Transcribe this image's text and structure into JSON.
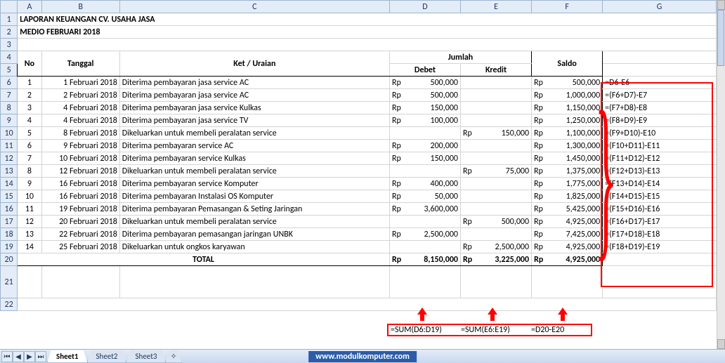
{
  "columns": [
    "A",
    "B",
    "C",
    "D",
    "E",
    "F",
    "G"
  ],
  "title1": "LAPORAN KEUANGAN CV. USAHA JASA",
  "title2": "MEDIO FEBRUARI 2018",
  "headers": {
    "no": "No",
    "tanggal": "Tanggal",
    "ket": "Ket / Uraian",
    "jumlah": "Jumlah",
    "debet": "Debet",
    "kredit": "Kredit",
    "saldo": "Saldo",
    "rp": "Rp"
  },
  "rows": [
    {
      "no": "1",
      "tgl": "1 Februari 2018",
      "ket": "Diterima pembayaran jasa service AC",
      "deb": "500,000",
      "kre": "",
      "saldo": "500,000",
      "f": "=D6-E6"
    },
    {
      "no": "2",
      "tgl": "2 Februari 2018",
      "ket": "Diterima pembayaran jasa service AC",
      "deb": "500,000",
      "kre": "",
      "saldo": "1,000,000",
      "f": "=(F6+D7)-E7"
    },
    {
      "no": "3",
      "tgl": "4 Februari 2018",
      "ket": "Diterima pembayaran jasa service Kulkas",
      "deb": "150,000",
      "kre": "",
      "saldo": "1,150,000",
      "f": "=(F7+D8)-E8"
    },
    {
      "no": "4",
      "tgl": "4 Februari 2018",
      "ket": "Diterima pembayaran jasa service TV",
      "deb": "100,000",
      "kre": "",
      "saldo": "1,250,000",
      "f": "=(F8+D9)-E9"
    },
    {
      "no": "5",
      "tgl": "8 Februari 2018",
      "ket": "Dikeluarkan untuk membeli peralatan service",
      "deb": "",
      "kre": "150,000",
      "saldo": "1,100,000",
      "f": "=(F9+D10)-E10"
    },
    {
      "no": "6",
      "tgl": "9 Februari 2018",
      "ket": "Diterima pembayaran service AC",
      "deb": "200,000",
      "kre": "",
      "saldo": "1,300,000",
      "f": "=(F10+D11)-E11"
    },
    {
      "no": "7",
      "tgl": "10 Februari 2018",
      "ket": "Diterima pembayaran service Kulkas",
      "deb": "150,000",
      "kre": "",
      "saldo": "1,450,000",
      "f": "=(F11+D12)-E12"
    },
    {
      "no": "8",
      "tgl": "12 Februari 2018",
      "ket": "Dikeluarkan untuk membeli peralatan service",
      "deb": "",
      "kre": "75,000",
      "saldo": "1,375,000",
      "f": "=(F12+D13)-E13"
    },
    {
      "no": "9",
      "tgl": "16 Februari 2018",
      "ket": "Diterima pembayaran service Komputer",
      "deb": "400,000",
      "kre": "",
      "saldo": "1,775,000",
      "f": "=(F13+D14)-E14"
    },
    {
      "no": "10",
      "tgl": "16 Februari 2018",
      "ket": "Diterima pembayaran Instalasi OS Komputer",
      "deb": "50,000",
      "kre": "",
      "saldo": "1,825,000",
      "f": "=(F14+D15)-E15"
    },
    {
      "no": "11",
      "tgl": "19 Februari 2018",
      "ket": "Diterima pembayaran Pemasangan & Seting Jaringan",
      "deb": "3,600,000",
      "kre": "",
      "saldo": "5,425,000",
      "f": "=(F15+D16)-E16"
    },
    {
      "no": "12",
      "tgl": "20 Februari 2018",
      "ket": "Dikeluarkan untuk membeli peralatan service",
      "deb": "",
      "kre": "500,000",
      "saldo": "4,925,000",
      "f": "=(F16+D17)-E17"
    },
    {
      "no": "13",
      "tgl": "22 Februari 2018",
      "ket": "Diterima pembayaran pemasangan jaringan UNBK",
      "deb": "2,500,000",
      "kre": "",
      "saldo": "7,425,000",
      "f": "=(F17+D18)-E18"
    },
    {
      "no": "14",
      "tgl": "25 Februari 2018",
      "ket": "Dikeluarkan untuk ongkos karyawan",
      "deb": "",
      "kre": "2,500,000",
      "saldo": "4,925,000",
      "f": "=(F18+D19)-E19"
    }
  ],
  "total": {
    "label": "TOTAL",
    "deb": "8,150,000",
    "kre": "3,225,000",
    "saldo": "4,925,000"
  },
  "sum_formulas": {
    "d": "=SUM(D6:D19)",
    "e": "=SUM(E6:E19)",
    "f": "=D20-E20"
  },
  "tabs": [
    "Sheet1",
    "Sheet2",
    "Sheet3"
  ],
  "footer_url": "www.modulkomputer.com",
  "chart_data": {
    "type": "table",
    "title": "LAPORAN KEUANGAN CV. USAHA JASA — MEDIO FEBRUARI 2018",
    "columns": [
      "No",
      "Tanggal",
      "Ket / Uraian",
      "Debet",
      "Kredit",
      "Saldo"
    ],
    "rows": [
      [
        1,
        "1 Februari 2018",
        "Diterima pembayaran jasa service AC",
        500000,
        null,
        500000
      ],
      [
        2,
        "2 Februari 2018",
        "Diterima pembayaran jasa service AC",
        500000,
        null,
        1000000
      ],
      [
        3,
        "4 Februari 2018",
        "Diterima pembayaran jasa service Kulkas",
        150000,
        null,
        1150000
      ],
      [
        4,
        "4 Februari 2018",
        "Diterima pembayaran jasa service TV",
        100000,
        null,
        1250000
      ],
      [
        5,
        "8 Februari 2018",
        "Dikeluarkan untuk membeli peralatan service",
        null,
        150000,
        1100000
      ],
      [
        6,
        "9 Februari 2018",
        "Diterima pembayaran service AC",
        200000,
        null,
        1300000
      ],
      [
        7,
        "10 Februari 2018",
        "Diterima pembayaran service Kulkas",
        150000,
        null,
        1450000
      ],
      [
        8,
        "12 Februari 2018",
        "Dikeluarkan untuk membeli peralatan service",
        null,
        75000,
        1375000
      ],
      [
        9,
        "16 Februari 2018",
        "Diterima pembayaran service Komputer",
        400000,
        null,
        1775000
      ],
      [
        10,
        "16 Februari 2018",
        "Diterima pembayaran Instalasi OS Komputer",
        50000,
        null,
        1825000
      ],
      [
        11,
        "19 Februari 2018",
        "Diterima pembayaran Pemasangan & Seting Jaringan",
        3600000,
        null,
        5425000
      ],
      [
        12,
        "20 Februari 2018",
        "Dikeluarkan untuk membeli peralatan service",
        null,
        500000,
        4925000
      ],
      [
        13,
        "22 Februari 2018",
        "Diterima pembayaran pemasangan jaringan UNBK",
        2500000,
        null,
        7425000
      ],
      [
        14,
        "25 Februari 2018",
        "Dikeluarkan untuk ongkos karyawan",
        null,
        2500000,
        4925000
      ]
    ],
    "totals": {
      "Debet": 8150000,
      "Kredit": 3225000,
      "Saldo": 4925000
    }
  }
}
